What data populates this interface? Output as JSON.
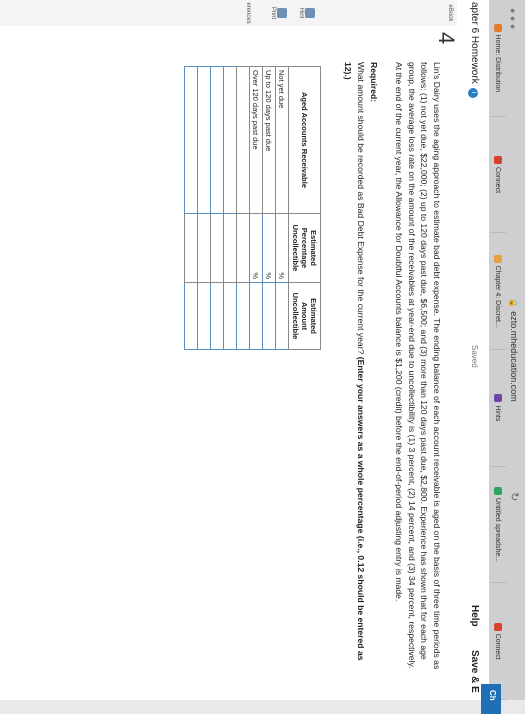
{
  "browser": {
    "address": "ezto.mheducation.com",
    "tabs": [
      "Home: Distribution",
      "Connect",
      "Chapter 4: Discret...",
      "Hints",
      "Untitled spreadshe...",
      "Connect"
    ],
    "tab_colors": [
      "#e57b2e",
      "#d7402b",
      "#e8a13a",
      "#6e46a9",
      "#2ba560",
      "#d7402b"
    ]
  },
  "header": {
    "title": "apter 6 Homework",
    "saved": "Saved",
    "help": "Help",
    "save_exit": "Save & E",
    "check": "Ch"
  },
  "rail": {
    "items": [
      "Hint",
      "Print",
      "erences"
    ],
    "ebook_label": "eBook"
  },
  "question": {
    "number": "4",
    "problem": "Lin's Dairy uses the aging approach to estimate bad debt expense. The ending balance of each account receivable is aged on the basis of three time periods as follows: (1) not yet due, $22,000; (2) up to 120 days past due, $6,500; and (3) more than 120 days past due, $2,800. Experience has shown that for each age group, the average loss rate on the amount of the receivables at year-end due to uncollectibility is (1) 3 percent, (2) 14 percent, and (3) 34 percent, respectively. At the end of the current year, the Allowance for Doubtful Accounts balance is $1,200 (credit) before the end-of-period adjusting entry is made.",
    "required_label": "Required:",
    "required_text": "What amount should be recorded as Bad Debt Expense for the current year?",
    "required_bold": "(Enter your answers as a whole percentage (i.e., 0.12 should be entered as 12).)"
  },
  "table": {
    "headers": [
      "Aged Accounts Receivable",
      "Estimated Percentage Uncollectible",
      "Estimated Amount Uncollectible"
    ],
    "rows": [
      {
        "label": "Not yet due",
        "pct_unit": "%"
      },
      {
        "label": "Up to 120 days past due",
        "pct_unit": "%"
      },
      {
        "label": "Over 120 days past due",
        "pct_unit": "%"
      }
    ]
  }
}
